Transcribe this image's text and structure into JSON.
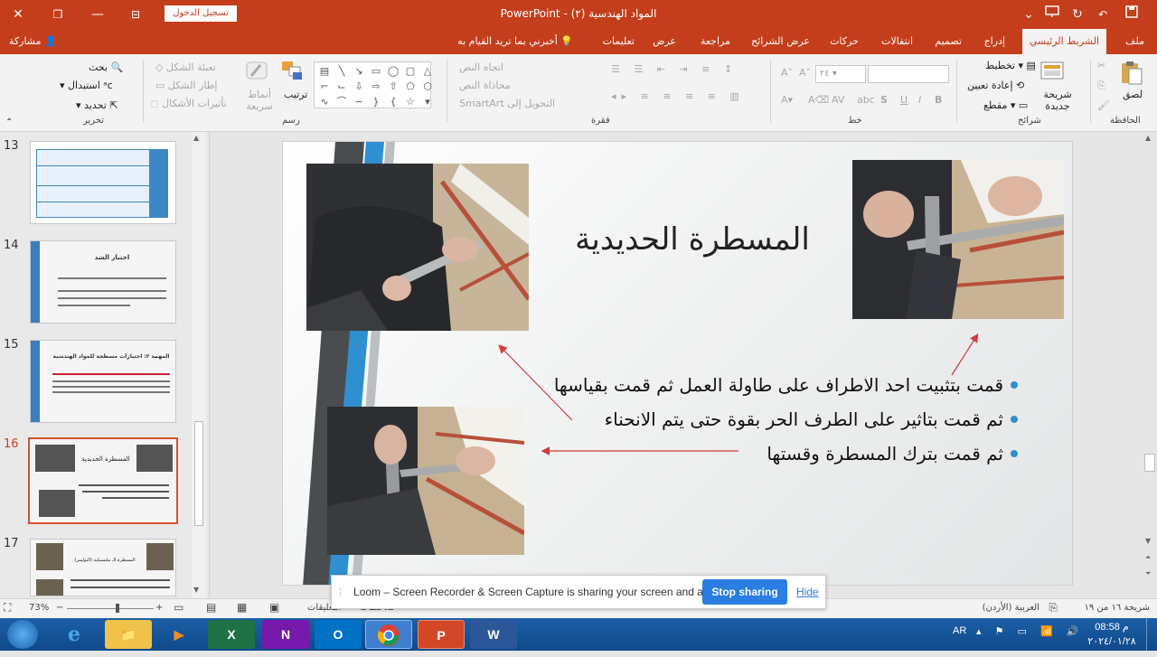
{
  "titlebar": {
    "title": "PowerPoint  -  المواد الهندسية (٢)",
    "signin": "تسجيل الدخول",
    "close": "✕",
    "restore": "❐",
    "minimize": "—",
    "options": "⊟",
    "save": "💾",
    "undo": "↶",
    "redo": "↻",
    "qat_more": "⌄"
  },
  "tabs": [
    "ملف",
    "الشريط الرئيسي",
    "إدراج",
    "تصميم",
    "انتقالات",
    "حركات",
    "عرض الشرائح",
    "مراجعة",
    "عرض",
    "تعليمات"
  ],
  "tellme": "أخبرني بما تريد القيام به",
  "share": "مشاركة",
  "ribbon": {
    "clipboard": {
      "paste": "لصق",
      "label": "الحافظة"
    },
    "slides": {
      "new_slide": "شريحة جديدة",
      "layout": "تخطيط",
      "reset": "إعادة تعيين",
      "section": "مقطع",
      "label": "شرائح"
    },
    "font": {
      "size": "٢٤",
      "label": "خط"
    },
    "paragraph": {
      "text_direction": "اتجاه النص",
      "align_text": "محاذاة النص",
      "smartart": "التحويل إلى SmartArt",
      "label": "فقرة"
    },
    "drawing": {
      "arrange": "ترتيب",
      "quick_styles": "أنماط سريعة",
      "fill": "تعبئة الشكل",
      "outline": "إطار الشكل",
      "effects": "تأثيرات الأشكال",
      "label": "رسم"
    },
    "editing": {
      "find": "بحث",
      "replace": "استبدال",
      "select": "تحديد",
      "label": "تحرير"
    }
  },
  "thumbnails": [
    {
      "num": "13",
      "title": ""
    },
    {
      "num": "14",
      "title": "اختبار الشد"
    },
    {
      "num": "15",
      "title": "المهمة ٢: اختبارات مسطحة للمواد الهندسية"
    },
    {
      "num": "16",
      "title": "المسطرة الحديدية"
    },
    {
      "num": "17",
      "title": "المسطرة الـ ملنسيكية (البوليمر)"
    }
  ],
  "slide": {
    "title": "المسطرة الحديدية",
    "bullets": [
      "قمت بتثبيت احد الاطراف على طاولة العمل ثم قمت بقياسها",
      "ثم قمت بتاثير على الطرف الحر بقوة حتى يتم الانحناء",
      "ثم قمت بترك المسطرة وقستها"
    ]
  },
  "statusbar": {
    "slide_info": "شريحة ١٦ من ١٩",
    "language": "العربية (الأردن)",
    "notes": "ملاحظات",
    "comments": "التعليقات",
    "zoom": "73%"
  },
  "loom": {
    "message": "Loom – Screen Recorder & Screen Capture is sharing your screen and audio.",
    "stop": "Stop sharing",
    "hide": "Hide"
  },
  "taskbar": {
    "lang": "AR",
    "time": "08:58 م",
    "date": "٢٠٢٤/٠١/٢٨"
  },
  "colors": {
    "accent": "#c43e1c",
    "slide_blue": "#2e8fd1",
    "taskbar": "#1c5fa6"
  }
}
